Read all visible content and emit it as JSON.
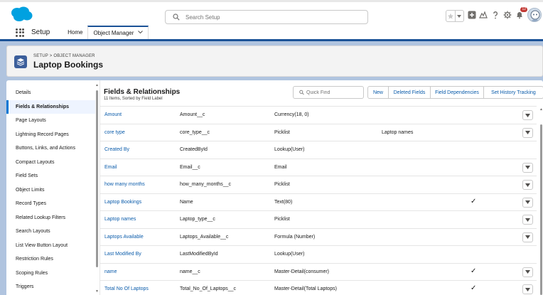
{
  "header": {
    "search_placeholder": "Search Setup",
    "notification_count": "12"
  },
  "nav": {
    "app_name": "Setup",
    "tabs": [
      {
        "label": "Home"
      },
      {
        "label": "Object Manager"
      }
    ]
  },
  "object": {
    "breadcrumb": "SETUP > OBJECT MANAGER",
    "title": "Laptop Bookings"
  },
  "sidebar": {
    "items": [
      {
        "label": "Details"
      },
      {
        "label": "Fields & Relationships"
      },
      {
        "label": "Page Layouts"
      },
      {
        "label": "Lightning Record Pages"
      },
      {
        "label": "Buttons, Links, and Actions"
      },
      {
        "label": "Compact Layouts"
      },
      {
        "label": "Field Sets"
      },
      {
        "label": "Object Limits"
      },
      {
        "label": "Record Types"
      },
      {
        "label": "Related Lookup Filters"
      },
      {
        "label": "Search Layouts"
      },
      {
        "label": "List View Button Layout"
      },
      {
        "label": "Restriction Rules"
      },
      {
        "label": "Scoping Rules"
      },
      {
        "label": "Triggers"
      }
    ],
    "active_index": 1
  },
  "section": {
    "title": "Fields & Relationships",
    "subtitle": "11 Items, Sorted by Field Label",
    "quick_find_placeholder": "Quick Find",
    "buttons": {
      "new": "New",
      "deleted_fields": "Deleted Fields",
      "field_dependencies": "Field Dependencies",
      "set_history_tracking": "Set History Tracking"
    }
  },
  "fields": [
    {
      "label": "Amount",
      "api": "Amount__c",
      "type": "Currency(18, 0)",
      "controlling": "",
      "indexed": "",
      "action": true
    },
    {
      "label": "core type",
      "api": "core_type__c",
      "type": "Picklist",
      "controlling": "Laptop names",
      "indexed": "",
      "action": true
    },
    {
      "label": "Created By",
      "api": "CreatedById",
      "type": "Lookup(User)",
      "controlling": "",
      "indexed": "",
      "action": false
    },
    {
      "label": "Email",
      "api": "Email__c",
      "type": "Email",
      "controlling": "",
      "indexed": "",
      "action": true
    },
    {
      "label": "how many months",
      "api": "how_many_months__c",
      "type": "Picklist",
      "controlling": "",
      "indexed": "",
      "action": true
    },
    {
      "label": "Laptop Bookings",
      "api": "Name",
      "type": "Text(80)",
      "controlling": "",
      "indexed": "✓",
      "action": true
    },
    {
      "label": "Laptop names",
      "api": "Laptop_type__c",
      "type": "Picklist",
      "controlling": "",
      "indexed": "",
      "action": true
    },
    {
      "label": "Laptops Available",
      "api": "Laptops_Available__c",
      "type": "Formula (Number)",
      "controlling": "",
      "indexed": "",
      "action": true
    },
    {
      "label": "Last Modified By",
      "api": "LastModifiedById",
      "type": "Lookup(User)",
      "controlling": "",
      "indexed": "",
      "action": false
    },
    {
      "label": "name",
      "api": "name__c",
      "type": "Master-Detail(consumer)",
      "controlling": "",
      "indexed": "✓",
      "action": true
    },
    {
      "label": "Total No Of Laptops",
      "api": "Total_No_Of_Laptops__c",
      "type": "Master-Detail(Total Laptops)",
      "controlling": "",
      "indexed": "✓",
      "action": true
    }
  ],
  "colors": {
    "brand": "#00a1e0",
    "link": "#0b5cab",
    "nav_accent": "#1b5297",
    "object_icon": "#3c5f9b"
  }
}
